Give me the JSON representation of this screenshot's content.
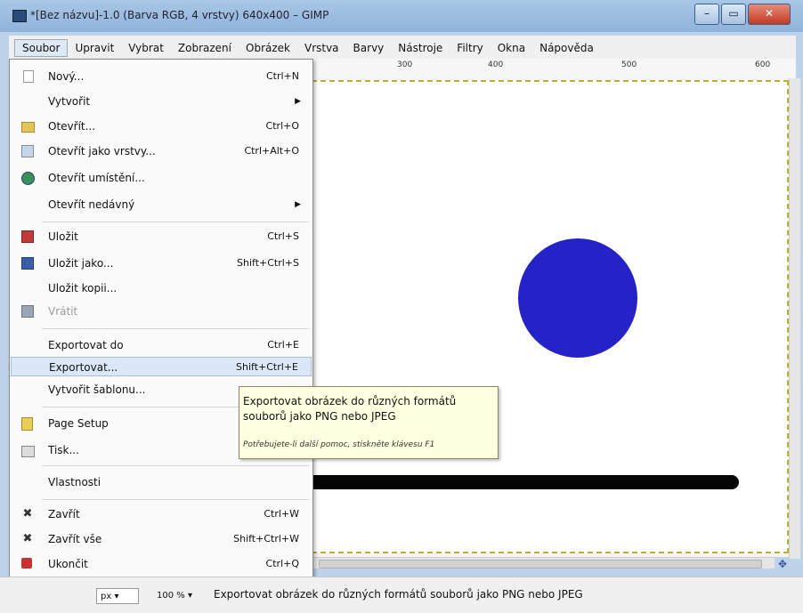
{
  "window": {
    "title": "*[Bez názvu]-1.0 (Barva RGB, 4 vrstvy) 640x400 – GIMP",
    "minimize_label": "–",
    "maximize_label": "▭",
    "close_label": "✕"
  },
  "menubar": {
    "items": [
      {
        "label": "Soubor"
      },
      {
        "label": "Upravit"
      },
      {
        "label": "Vybrat"
      },
      {
        "label": "Zobrazení"
      },
      {
        "label": "Obrázek"
      },
      {
        "label": "Vrstva"
      },
      {
        "label": "Barvy"
      },
      {
        "label": "Nástroje"
      },
      {
        "label": "Filtry"
      },
      {
        "label": "Okna"
      },
      {
        "label": "Nápověda"
      }
    ]
  },
  "ruler": {
    "labels": [
      "300",
      "400",
      "500",
      "600"
    ]
  },
  "file_menu": {
    "items": [
      {
        "label": "Nový...",
        "shortcut": "Ctrl+N",
        "icon": "new-file-icon"
      },
      {
        "label": "Vytvořit",
        "arrow": "▶"
      },
      {
        "label": "Otevřít...",
        "shortcut": "Ctrl+O",
        "icon": "open-folder-icon"
      },
      {
        "label": "Otevřít jako vrstvy...",
        "shortcut": "Ctrl+Alt+O",
        "icon": "open-layers-icon"
      },
      {
        "label": "Otevřít umístění...",
        "icon": "globe-icon"
      },
      {
        "label": "Otevřít nedávný",
        "arrow": "▶"
      },
      {
        "label": "Uložit",
        "shortcut": "Ctrl+S",
        "icon": "save-icon"
      },
      {
        "label": "Uložit jako...",
        "shortcut": "Shift+Ctrl+S",
        "icon": "save-as-icon"
      },
      {
        "label": "Uložit kopii..."
      },
      {
        "label": "Vrátit",
        "icon": "revert-icon"
      },
      {
        "label": "Exportovat do",
        "shortcut": "Ctrl+E"
      },
      {
        "label": "Exportovat...",
        "shortcut": "Shift+Ctrl+E"
      },
      {
        "label": "Vytvořit šablonu..."
      },
      {
        "label": "Page Setup",
        "icon": "page-setup-icon"
      },
      {
        "label": "Tisk...",
        "icon": "print-icon"
      },
      {
        "label": "Vlastnosti"
      },
      {
        "label": "Zavřít",
        "shortcut": "Ctrl+W",
        "icon": "close-icon"
      },
      {
        "label": "Zavřít vše",
        "shortcut": "Shift+Ctrl+W",
        "icon": "close-all-icon"
      },
      {
        "label": "Ukončit",
        "shortcut": "Ctrl+Q",
        "icon": "quit-icon"
      }
    ]
  },
  "tooltip": {
    "text": "Exportovat obrázek do různých formátů souborů jako PNG nebo JPEG",
    "hint": "Potřebujete-li další pomoc, stiskněte klávesu F1"
  },
  "statusbar": {
    "unit": "px",
    "zoom": "100 %",
    "message": "Exportovat obrázek do různých formátů souborů jako PNG nebo JPEG"
  },
  "colors": {
    "circle": "#2323c8",
    "line": "#050505",
    "tooltip_bg": "#ffffe1",
    "menu_highlight": "#dbe7f7"
  }
}
